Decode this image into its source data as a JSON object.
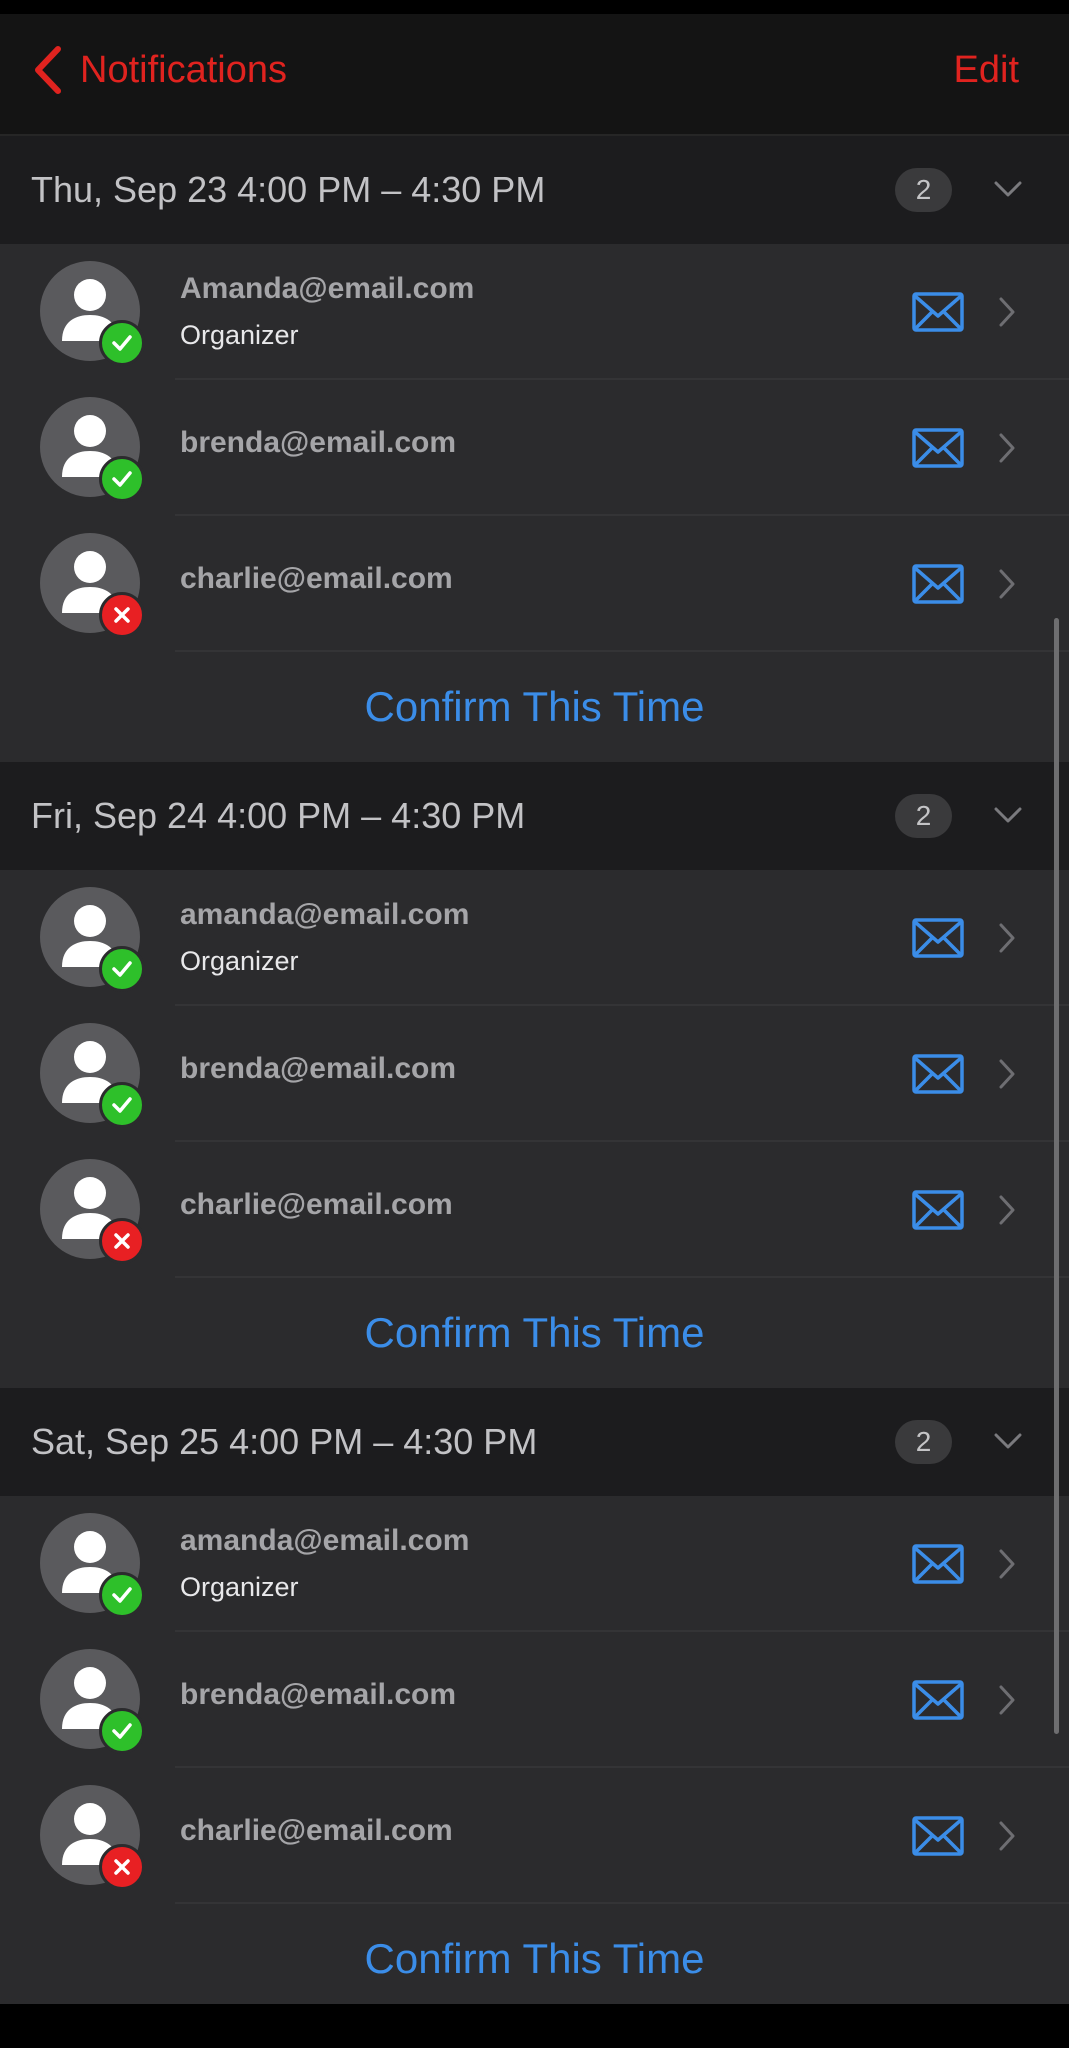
{
  "nav": {
    "back_label": "Notifications",
    "edit_label": "Edit"
  },
  "colors": {
    "accent": "#e0231f",
    "link": "#3b8de8",
    "accepted": "#2ec02a",
    "declined": "#e82023"
  },
  "sections": [
    {
      "date": "Thu, Sep 23 4:00 PM – 4:30 PM",
      "count": "2",
      "attendees": [
        {
          "email": "Amanda@email.com",
          "role": "Organizer",
          "status": "accepted"
        },
        {
          "email": "brenda@email.com",
          "role": "",
          "status": "accepted"
        },
        {
          "email": "charlie@email.com",
          "role": "",
          "status": "declined"
        }
      ],
      "confirm_label": "Confirm This Time"
    },
    {
      "date": "Fri, Sep 24 4:00 PM – 4:30 PM",
      "count": "2",
      "attendees": [
        {
          "email": "amanda@email.com",
          "role": "Organizer",
          "status": "accepted"
        },
        {
          "email": "brenda@email.com",
          "role": "",
          "status": "accepted"
        },
        {
          "email": "charlie@email.com",
          "role": "",
          "status": "declined"
        }
      ],
      "confirm_label": "Confirm This Time"
    },
    {
      "date": "Sat, Sep 25 4:00 PM – 4:30 PM",
      "count": "2",
      "attendees": [
        {
          "email": "amanda@email.com",
          "role": "Organizer",
          "status": "accepted"
        },
        {
          "email": "brenda@email.com",
          "role": "",
          "status": "accepted"
        },
        {
          "email": "charlie@email.com",
          "role": "",
          "status": "declined"
        }
      ],
      "confirm_label": "Confirm This Time"
    }
  ]
}
